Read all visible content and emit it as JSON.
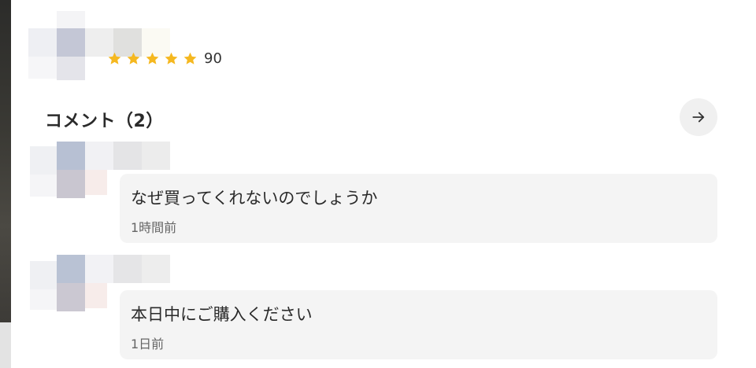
{
  "seller": {
    "rating": {
      "stars": 5,
      "value": "90",
      "star_color": "#F5B820"
    }
  },
  "comments": {
    "title": "コメント（2）",
    "more_icon": "arrow-right-icon",
    "items": [
      {
        "text": "なぜ買ってくれないのでしょうか",
        "time": "1時間前"
      },
      {
        "text": "本日中にご購入ください",
        "time": "1日前"
      }
    ]
  }
}
